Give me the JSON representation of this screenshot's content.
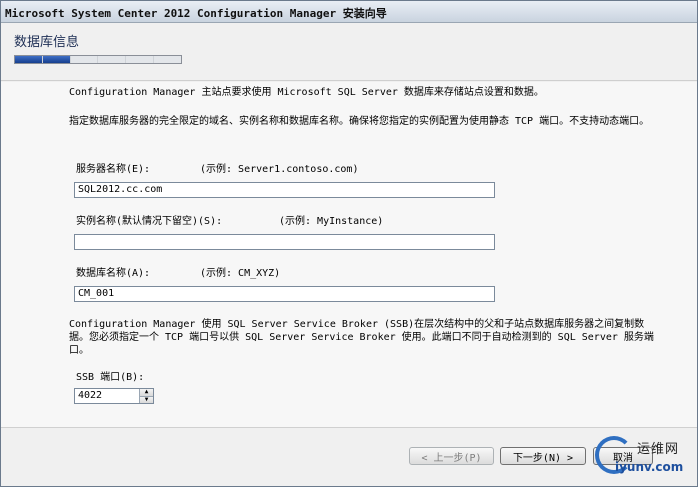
{
  "window": {
    "title": "Microsoft System Center 2012 Configuration Manager 安装向导"
  },
  "header": {
    "page_title": "数据库信息",
    "progress": {
      "total_steps": 6,
      "completed_steps": 2
    }
  },
  "main": {
    "intro": "Configuration Manager 主站点要求使用 Microsoft SQL Server 数据库来存储站点设置和数据。",
    "description": "指定数据库服务器的完全限定的域名、实例名称和数据库名称。确保将您指定的实例配置为使用静态 TCP 端口。不支持动态端口。",
    "server_name": {
      "label": "服务器名称(E):",
      "example": "(示例: Server1.contoso.com)",
      "value": "SQL2012.cc.com"
    },
    "instance_name": {
      "label": "实例名称(默认情况下留空)(S):",
      "example": "(示例: MyInstance)",
      "value": ""
    },
    "database_name": {
      "label": "数据库名称(A):",
      "example": "(示例: CM_XYZ)",
      "value": "CM_001"
    },
    "ssb_description": "Configuration Manager 使用 SQL Server Service Broker (SSB)在层次结构中的父和子站点数据库服务器之间复制数据。您必须指定一个 TCP 端口号以供 SQL Server Service Broker 使用。此端口不同于自动检测到的 SQL Server 服务端口。",
    "ssb_port": {
      "label": "SSB 端口(B):",
      "value": "4022"
    }
  },
  "footer": {
    "prev_label": "< 上一步(P)",
    "next_label": "下一步(N) >",
    "cancel_label": "取消"
  },
  "watermark": {
    "line1": "运维网",
    "line2": "iyunv.com"
  }
}
